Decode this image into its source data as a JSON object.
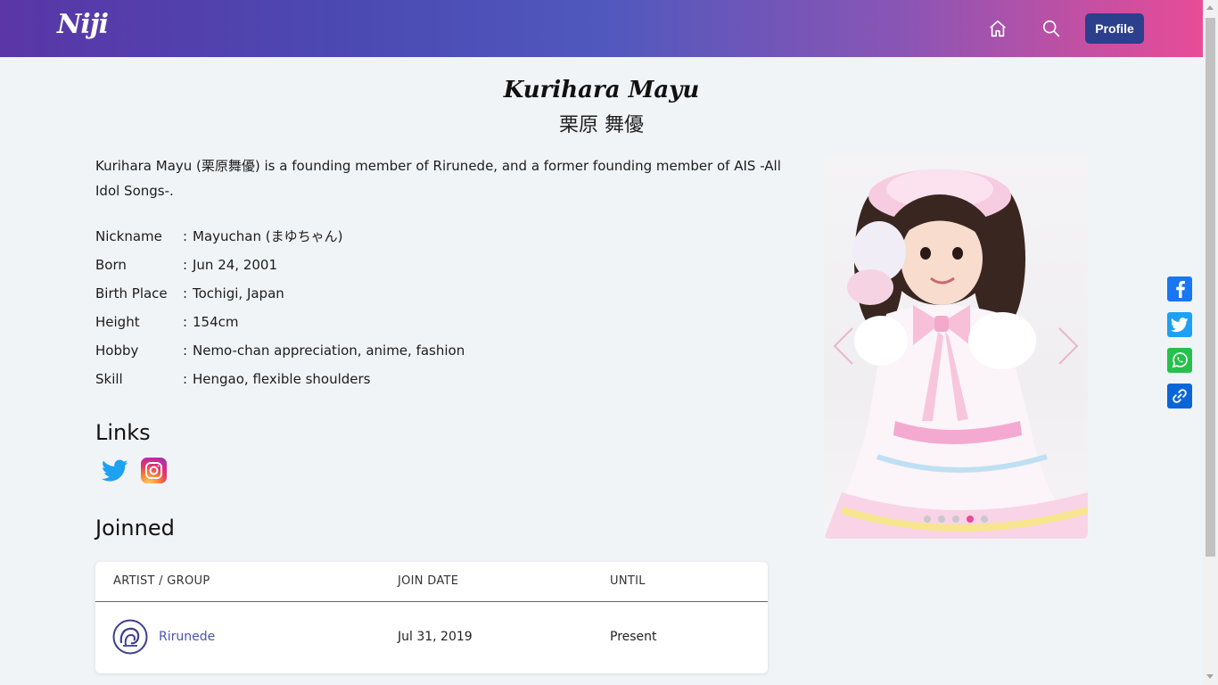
{
  "header": {
    "logo": "Niji",
    "profile_label": "Profile"
  },
  "member": {
    "name_en": "Kurihara Mayu",
    "name_jp": "栗原 舞優",
    "description": "Kurihara Mayu (栗原舞優) is a founding member of Rirunede, and a former founding member of AIS -All Idol Songs-.",
    "info": [
      {
        "label": "Nickname",
        "value": "Mayuchan (まゆちゃん)"
      },
      {
        "label": "Born",
        "value": "Jun 24, 2001"
      },
      {
        "label": "Birth Place",
        "value": "Tochigi, Japan"
      },
      {
        "label": "Height",
        "value": "154cm"
      },
      {
        "label": "Hobby",
        "value": "Nemo-chan appreciation, anime, fashion"
      },
      {
        "label": "Skill",
        "value": "Hengao, flexible shoulders"
      }
    ],
    "colon": ":"
  },
  "links": {
    "title": "Links",
    "icons": [
      "twitter-icon",
      "instagram-icon"
    ]
  },
  "joined": {
    "title": "Joinned",
    "columns": [
      "ARTIST / GROUP",
      "JOIN DATE",
      "UNTIL"
    ],
    "rows": [
      {
        "group": "Rirunede",
        "join_date": "Jul 31, 2019",
        "until": "Present"
      }
    ]
  },
  "carousel": {
    "slide_count": 5,
    "active_index": 3
  },
  "share": [
    "facebook-icon",
    "twitter-icon",
    "whatsapp-icon",
    "copy-link-icon"
  ],
  "colors": {
    "accent_pink": "#e84c97",
    "header_start": "#5a36a6",
    "profile_button": "#2c3f8c",
    "link_color": "#4a55a8"
  }
}
